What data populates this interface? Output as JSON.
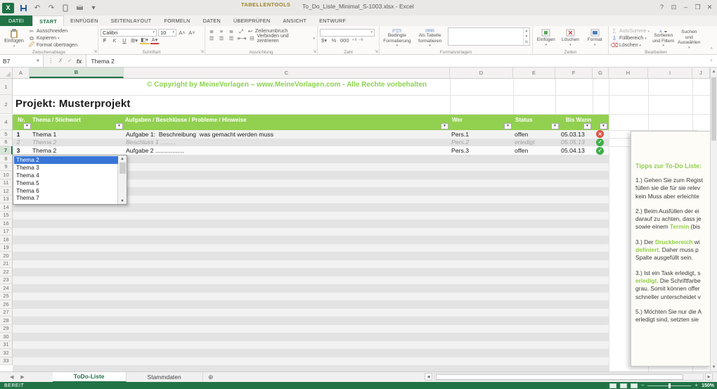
{
  "titlebar": {
    "context_tools": "TABELLENTOOLS",
    "title": "To_Do_Liste_Minimal_S-1003.xlsx - Excel",
    "window_buttons": [
      "help",
      "ribbon-options",
      "minimize",
      "restore",
      "close"
    ]
  },
  "ribbon_tabs": [
    {
      "label": "DATEI",
      "type": "file"
    },
    {
      "label": "START",
      "active": true
    },
    {
      "label": "EINFÜGEN"
    },
    {
      "label": "SEITENLAYOUT"
    },
    {
      "label": "FORMELN"
    },
    {
      "label": "DATEN"
    },
    {
      "label": "ÜBERPRÜFEN"
    },
    {
      "label": "ANSICHT"
    },
    {
      "label": "ENTWURF",
      "contextual": true
    }
  ],
  "ribbon": {
    "clipboard": {
      "label": "Zwischenablage",
      "paste": "Einfügen",
      "cut": "Ausschneiden",
      "copy": "Kopieren",
      "painter": "Format übertragen"
    },
    "font": {
      "label": "Schriftart",
      "family": "Calibri",
      "size": "10",
      "bold": "F",
      "italic": "K",
      "underline": "U"
    },
    "alignment": {
      "label": "Ausrichtung",
      "wrap": "Zeilenumbruch",
      "merge": "Verbinden und zentrieren"
    },
    "number": {
      "label": "Zahl"
    },
    "styles": {
      "label": "Formatvorlagen",
      "conditional": "Bedingte Formatierung",
      "as_table": "Als Tabelle formatieren"
    },
    "cells": {
      "label": "Zellen",
      "insert": "Einfügen",
      "delete": "Löschen",
      "format": "Format"
    },
    "editing": {
      "label": "Bearbeiten",
      "autosum": "AutoSumme",
      "fill": "Füllbereich",
      "clear": "Löschen",
      "sort": "Sortieren und Filtern",
      "find": "Suchen und Auswählen"
    }
  },
  "formula_bar": {
    "name_box": "B7",
    "value": "Thema 2",
    "fx": "fx"
  },
  "grid": {
    "col_letters": [
      "A",
      "B",
      "C",
      "D",
      "E",
      "F",
      "G",
      "H",
      "I",
      "J"
    ],
    "selected_col": "B",
    "selected_row": "7",
    "copyright": "© Copyright by MeineVorlagen – www.MeineVorlagen.com - Alle Rechte vorbehalten",
    "project_title": "Projekt: Musterprojekt",
    "headers": [
      "Nr.",
      "Thema / Stichwort",
      "Aufgaben / Beschlüsse / Probleme / Hinweise",
      "Wer",
      "Status",
      "Bis Wann"
    ],
    "rows": [
      {
        "nr": "1",
        "thema": "Thema 1",
        "task": "Aufgabe 1:  Beschreibung  was gemacht werden muss",
        "wer": "Pers.1",
        "status": "offen",
        "due": "05.03.13",
        "icon": "red-x",
        "done": false
      },
      {
        "nr": "2",
        "thema": "Thema 2",
        "task": "Beschluss 1 .........",
        "wer": "Pers.2",
        "status": "erledigt",
        "due": "05.05.13",
        "icon": "green-check",
        "done": true
      },
      {
        "nr": "3",
        "thema": "Thema 2",
        "task": "Aufgabe 2 .................",
        "wer": "Pers.3",
        "status": "offen",
        "due": "05.04.13",
        "icon": "green-check",
        "done": false
      }
    ],
    "dropdown": {
      "items": [
        "Thema 2",
        "Thema 3",
        "Thema 4",
        "Thema 5",
        "Thema 6",
        "Thema 7"
      ],
      "selected": "Thema 2"
    }
  },
  "tips": {
    "heading": "Tipps zur To-Do Liste:",
    "paragraphs": [
      [
        [
          {
            "t": "1.) Gehen Sie zum Regist"
          }
        ],
        [
          {
            "t": "füllen sie die für sie relev"
          }
        ],
        [
          {
            "t": "kein Muss aber erleichte"
          }
        ]
      ],
      [
        [
          {
            "t": "2.) Beim Ausfüllen der ei"
          }
        ],
        [
          {
            "t": "darauf zu achten, dass je"
          }
        ],
        [
          {
            "t": "sowie einem "
          },
          {
            "t": "Termin",
            "g": true
          },
          {
            "t": " (bis"
          }
        ]
      ],
      [
        [
          {
            "t": "3.) Der "
          },
          {
            "t": "Druckbereich",
            "g": true
          },
          {
            "t": " wi"
          }
        ],
        [
          {
            "t": "definiert",
            "g": true
          },
          {
            "t": ". Daher muss p"
          }
        ],
        [
          {
            "t": "Spalte ausgefüllt sein."
          }
        ]
      ],
      [
        [
          {
            "t": "3.) Ist ein Task erledigt, s"
          }
        ],
        [
          {
            "t": "erledigt",
            "g": true
          },
          {
            "t": ". Die Schriftfarbe"
          }
        ],
        [
          {
            "t": "grau. Somit können offer"
          }
        ],
        [
          {
            "t": "schneller unterscheidet v"
          }
        ]
      ],
      [
        [
          {
            "t": "5.) Möchten Sie nur die A"
          }
        ],
        [
          {
            "t": "erledigt sind, setzten sie"
          }
        ]
      ]
    ]
  },
  "sheet_tabs": {
    "tabs": [
      "ToDo-Liste",
      "Stammdaten"
    ],
    "active": "ToDo-Liste"
  },
  "status_bar": {
    "mode": "BEREIT",
    "zoom": "150%"
  },
  "colors": {
    "accent": "#217346",
    "band_green": "#92d050",
    "done_green": "#3fae49",
    "alert_red": "#dd5347",
    "selection_blue": "#3875d7"
  }
}
